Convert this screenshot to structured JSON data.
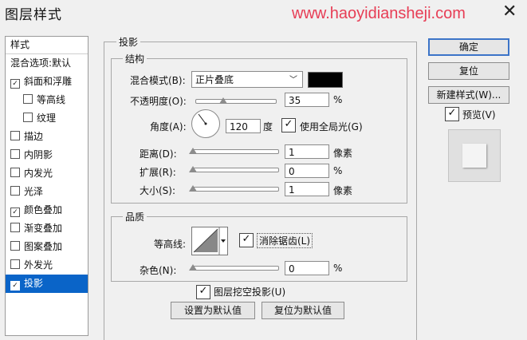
{
  "window": {
    "title": "图层样式",
    "watermark": "www.haoyidiansheji.com",
    "close_symbol": "✕"
  },
  "sidebar": {
    "header": "样式",
    "items": [
      {
        "label": "混合选项:默认",
        "checkbox": false,
        "checked": false,
        "indent": false
      },
      {
        "label": "斜面和浮雕",
        "checkbox": true,
        "checked": true,
        "indent": false
      },
      {
        "label": "等高线",
        "checkbox": true,
        "checked": false,
        "indent": true
      },
      {
        "label": "纹理",
        "checkbox": true,
        "checked": false,
        "indent": true
      },
      {
        "label": "描边",
        "checkbox": true,
        "checked": false,
        "indent": false
      },
      {
        "label": "内阴影",
        "checkbox": true,
        "checked": false,
        "indent": false
      },
      {
        "label": "内发光",
        "checkbox": true,
        "checked": false,
        "indent": false
      },
      {
        "label": "光泽",
        "checkbox": true,
        "checked": false,
        "indent": false
      },
      {
        "label": "颜色叠加",
        "checkbox": true,
        "checked": true,
        "indent": false
      },
      {
        "label": "渐变叠加",
        "checkbox": true,
        "checked": false,
        "indent": false
      },
      {
        "label": "图案叠加",
        "checkbox": true,
        "checked": false,
        "indent": false
      },
      {
        "label": "外发光",
        "checkbox": true,
        "checked": false,
        "indent": false
      },
      {
        "label": "投影",
        "checkbox": true,
        "checked": true,
        "indent": false,
        "selected": true
      }
    ]
  },
  "drop_shadow": {
    "title": "投影",
    "structure": {
      "title": "结构",
      "blend_mode_label": "混合模式(B):",
      "blend_mode_value": "正片叠底",
      "shadow_color": "#000000",
      "opacity_label": "不透明度(O):",
      "opacity_value": "35",
      "opacity_unit": "%",
      "opacity_level": 0.35,
      "angle_label": "角度(A):",
      "angle_value": "120",
      "angle_unit": "度",
      "global_light_label": "使用全局光(G)",
      "global_light_checked": true,
      "distance_label": "距离(D):",
      "distance_value": "1",
      "distance_unit": "像素",
      "spread_label": "扩展(R):",
      "spread_value": "0",
      "spread_unit": "%",
      "size_label": "大小(S):",
      "size_value": "1",
      "size_unit": "像素"
    },
    "quality": {
      "title": "品质",
      "contour_label": "等高线:",
      "anti_alias_label": "消除锯齿(L)",
      "anti_alias_checked": true,
      "noise_label": "杂色(N):",
      "noise_value": "0",
      "noise_unit": "%"
    },
    "knockout_label": "图层挖空投影(U)",
    "knockout_checked": true,
    "make_default_label": "设置为默认值",
    "reset_default_label": "复位为默认值"
  },
  "actions": {
    "ok_label": "确定",
    "reset_label": "复位",
    "new_style_label": "新建样式(W)...",
    "preview_label": "预览(V)",
    "preview_checked": true
  },
  "colors": {
    "selection": "#0a64c8",
    "watermark": "#e73d55",
    "accent_border": "#3c74c8"
  }
}
